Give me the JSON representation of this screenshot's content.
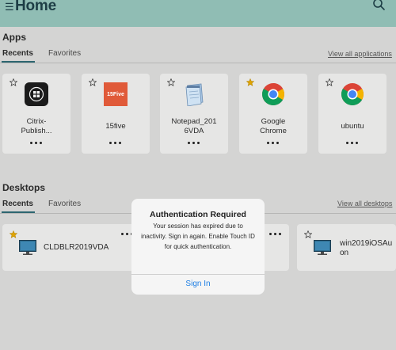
{
  "header": {
    "menu_icon": "hamburger-icon",
    "title": "Home",
    "search_icon": "search-icon"
  },
  "apps": {
    "title": "Apps",
    "tabs": [
      {
        "label": "Recents",
        "active": true
      },
      {
        "label": "Favorites",
        "active": false
      }
    ],
    "view_all": "View all applications",
    "items": [
      {
        "name": "Citrix-\nPublish...",
        "favorite": false,
        "icon": "citrix-publisher-icon"
      },
      {
        "name": "15five",
        "favorite": false,
        "icon": "15five-icon",
        "icon_text": "15Five"
      },
      {
        "name": "Notepad_201\n6VDA",
        "favorite": false,
        "icon": "notepad-icon"
      },
      {
        "name": "Google\nChrome",
        "favorite": true,
        "icon": "chrome-icon"
      },
      {
        "name": "ubuntu",
        "favorite": false,
        "icon": "chrome-icon"
      }
    ]
  },
  "desktops": {
    "title": "Desktops",
    "tabs": [
      {
        "label": "Recents",
        "active": true
      },
      {
        "label": "Favorites",
        "active": false
      }
    ],
    "view_all": "View all desktops",
    "items": [
      {
        "name": "CLDBLR2019VDA",
        "favorite": true,
        "icon": "monitor-icon"
      },
      {
        "name": "win2019iOSAu\non",
        "favorite": false,
        "icon": "monitor-icon"
      }
    ]
  },
  "dialog": {
    "title": "Authentication Required",
    "body": "Your session has expired due to inactivity. Sign in again. Enable Touch ID for quick authentication.",
    "button": "Sign In"
  },
  "colors": {
    "header": "#90bdb4",
    "accent": "#2d6670",
    "star_favorite": "#e0a400",
    "link": "#1e7ee4"
  }
}
